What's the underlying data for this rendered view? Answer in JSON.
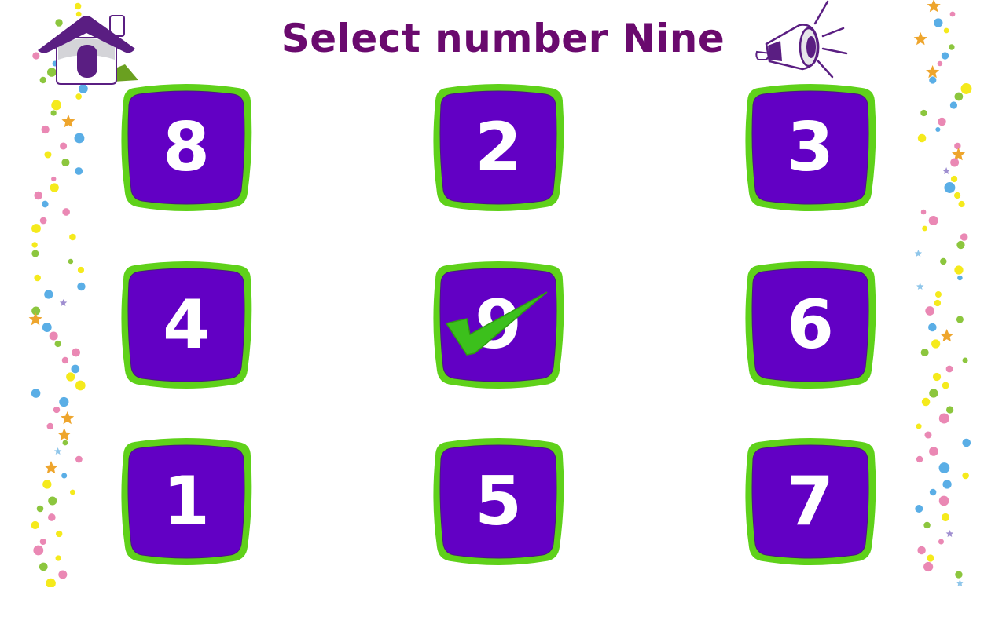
{
  "header": {
    "title": "Select number Nine",
    "home_icon": "home-icon",
    "speaker_icon": "megaphone-icon"
  },
  "target_number": 9,
  "colors": {
    "title": "#6a0a6e",
    "tile_fill": "#6200c4",
    "tile_border": "#5fd11a",
    "check": "#3cc01c",
    "home_roof": "#5a1e82",
    "accent_green": "#6aa020"
  },
  "tiles": [
    {
      "label": "8",
      "selected": false
    },
    {
      "label": "2",
      "selected": false
    },
    {
      "label": "3",
      "selected": false
    },
    {
      "label": "4",
      "selected": false
    },
    {
      "label": "9",
      "selected": true,
      "mark": "checkmark-icon"
    },
    {
      "label": "6",
      "selected": false
    },
    {
      "label": "1",
      "selected": false
    },
    {
      "label": "5",
      "selected": false
    },
    {
      "label": "7",
      "selected": false
    }
  ]
}
